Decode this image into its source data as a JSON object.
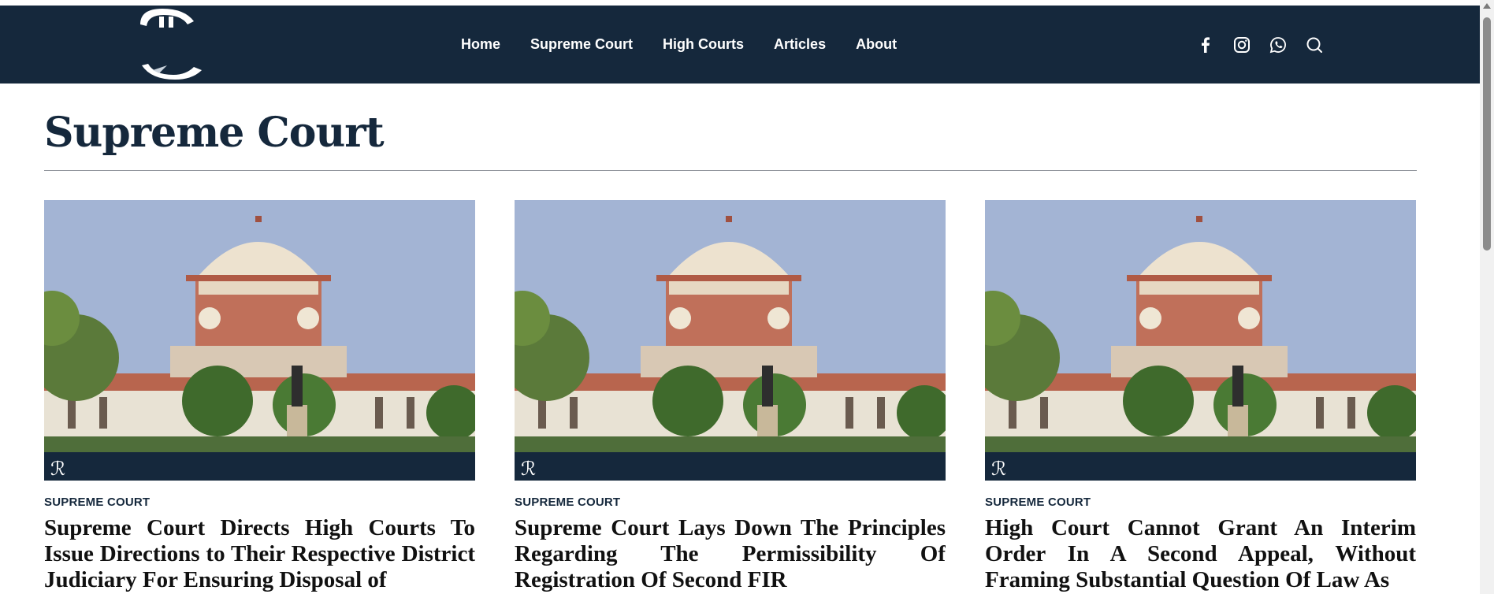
{
  "nav": {
    "items": [
      {
        "label": "Home"
      },
      {
        "label": "Supreme Court"
      },
      {
        "label": "High Courts"
      },
      {
        "label": "Articles"
      },
      {
        "label": "About"
      }
    ]
  },
  "social": {
    "icons": [
      "facebook-icon",
      "instagram-icon",
      "whatsapp-icon",
      "search-icon"
    ]
  },
  "page": {
    "title": "Supreme Court"
  },
  "cards": [
    {
      "category": "SUPREME COURT",
      "headline": "Supreme Court Directs High Courts To Issue Directions to Their Respective District Judiciary For Ensuring Disposal of"
    },
    {
      "category": "SUPREME COURT",
      "headline": "Supreme Court Lays Down The Principles Regarding The Permissibility Of Registration Of Second FIR"
    },
    {
      "category": "SUPREME COURT",
      "headline": "High Court Cannot Grant An Interim Order In A Second Appeal, Without Framing Substantial Question Of Law As"
    }
  ],
  "colors": {
    "header_bg": "#15283c",
    "title": "#15283c",
    "sky": "#a3b4d4"
  }
}
